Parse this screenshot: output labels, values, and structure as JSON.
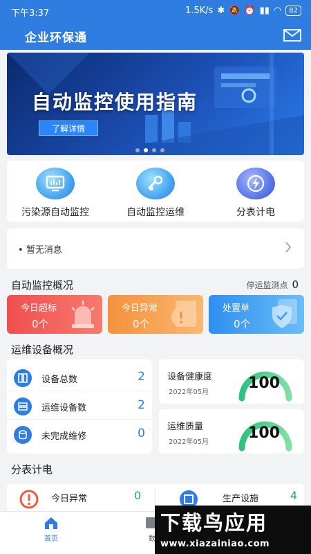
{
  "status_bar": {
    "time": "下午3:37",
    "speed": "1.5K/s",
    "battery": "82"
  },
  "header": {
    "title": "企业环保通"
  },
  "banner": {
    "title": "自动监控使用指南",
    "button": "了解详情"
  },
  "quick_menu": [
    {
      "label": "污染源自动监控",
      "icon": "monitor-icon"
    },
    {
      "label": "自动监控运维",
      "icon": "maintenance-icon"
    },
    {
      "label": "分表计电",
      "icon": "lightning-icon"
    }
  ],
  "notice": {
    "text": "暂无消息"
  },
  "monitoring": {
    "title": "自动监控概况",
    "stopped_label": "停运监测点",
    "stopped_value": "0",
    "cards": [
      {
        "title": "今日超标",
        "value": "0个",
        "color": "#f25a5a"
      },
      {
        "title": "今日异常",
        "value": "0个",
        "color": "#f7a14b"
      },
      {
        "title": "处置单",
        "value": "0个",
        "color": "#3aa2f2"
      }
    ]
  },
  "equipment": {
    "title": "运维设备概况",
    "rows": [
      {
        "label": "设备总数",
        "value": "2"
      },
      {
        "label": "运维设备数",
        "value": "2"
      },
      {
        "label": "未完成维修",
        "value": "0"
      }
    ],
    "health": {
      "title": "设备健康度",
      "date": "2022年05月",
      "value": "100",
      "percent": 100
    },
    "quality": {
      "title": "运维质量",
      "date": "2022年05月",
      "value": "100",
      "percent": 100
    }
  },
  "meter": {
    "title": "分表计电",
    "items": [
      {
        "label": "今日异常",
        "value": "0"
      },
      {
        "label": "生产设施",
        "value": "4"
      }
    ]
  },
  "tabbar": {
    "home": "首页",
    "data": "数"
  },
  "watermark": {
    "name": "下载鸟应用",
    "url": "www.xiazainiao.com"
  },
  "colors": {
    "primary": "#2f7de1",
    "red": "#f25a5a",
    "orange": "#f7a14b",
    "blue": "#3aa2f2",
    "green": "#1ea57b"
  }
}
